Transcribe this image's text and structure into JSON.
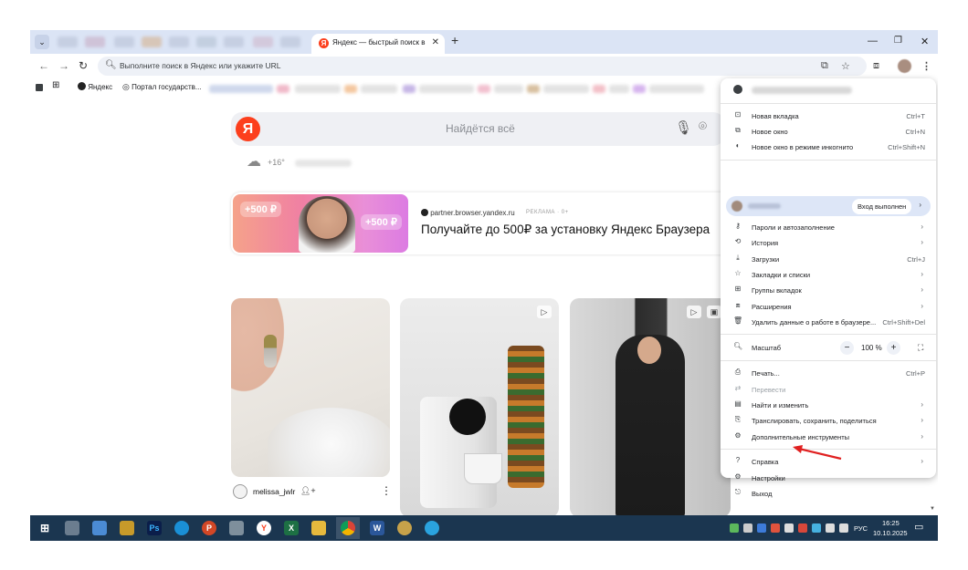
{
  "browser": {
    "tab_title": "Яндекс — быстрый поиск в ин",
    "favicon_letter": "Я",
    "omnibox_placeholder": "Выполните поиск в Яндекс или укажите URL"
  },
  "bookmarks": {
    "items": [
      "Яндекс",
      "Портал государств..."
    ]
  },
  "page": {
    "logo_letter": "Я",
    "search_placeholder": "Найдётся всё",
    "weather_temp": "+16°",
    "ad": {
      "badge_left": "+500 ₽",
      "badge_right": "+500 ₽",
      "source": "partner.browser.yandex.ru",
      "tag": "РЕКЛАМА · 0+",
      "title": "Получайте до 500₽ за установку Яндекс Браузера"
    },
    "card_author": "melissa_jwlr"
  },
  "menu": {
    "items_1": [
      {
        "label": "Новая вкладка",
        "shortcut": "Ctrl+T",
        "icon": "new-tab-icon"
      },
      {
        "label": "Новое окно",
        "shortcut": "Ctrl+N",
        "icon": "new-window-icon"
      },
      {
        "label": "Новое окно в режиме инкогнито",
        "shortcut": "Ctrl+Shift+N",
        "icon": "incognito-icon"
      }
    ],
    "signin_label": "Вход выполнен",
    "items_2": [
      {
        "label": "Пароли и автозаполнение",
        "icon": "key-icon"
      },
      {
        "label": "История",
        "icon": "history-icon"
      },
      {
        "label": "Загрузки",
        "shortcut": "Ctrl+J",
        "icon": "download-icon"
      },
      {
        "label": "Закладки и списки",
        "icon": "star-icon"
      },
      {
        "label": "Группы вкладок",
        "icon": "tab-groups-icon"
      },
      {
        "label": "Расширения",
        "icon": "extensions-icon"
      },
      {
        "label": "Удалить данные о работе в браузере...",
        "shortcut": "Ctrl+Shift+Del",
        "icon": "trash-icon"
      }
    ],
    "zoom": {
      "label": "Масштаб",
      "minus": "−",
      "value": "100 %",
      "plus": "+"
    },
    "items_3": [
      {
        "label": "Печать...",
        "shortcut": "Ctrl+P",
        "icon": "print-icon"
      },
      {
        "label": "Перевести",
        "icon": "translate-icon",
        "disabled": true
      },
      {
        "label": "Найти и изменить",
        "icon": "find-icon"
      },
      {
        "label": "Транслировать, сохранить, поделиться",
        "icon": "cast-icon"
      },
      {
        "label": "Дополнительные инструменты",
        "icon": "tools-icon"
      }
    ],
    "items_4": [
      {
        "label": "Справка",
        "icon": "help-icon"
      },
      {
        "label": "Настройки",
        "icon": "settings-icon"
      },
      {
        "label": "Выход",
        "icon": "exit-icon"
      }
    ]
  },
  "taskbar": {
    "lang": "РУС",
    "time": "16:25",
    "date": "10.10.2025"
  },
  "colors": {
    "yandex_red": "#fc3f1d",
    "annotation_arrow": "#e02020"
  }
}
